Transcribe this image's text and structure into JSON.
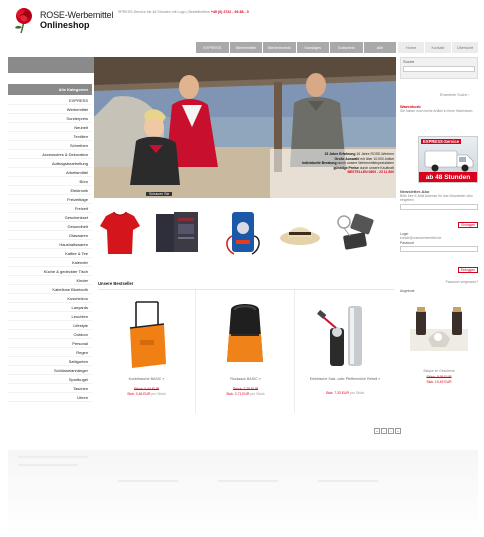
{
  "header": {
    "brand_line1": "ROSE-Werbemittel",
    "brand_line2": "Onlineshop",
    "top_info_text": "SPRESS-Service bis 48 Stunden mit Logo | Bestellhotline",
    "top_info_phone": "+49 (0) 2722 - 93 88 - 0"
  },
  "top_nav": [
    "EXPRESS",
    "Werbemittel",
    "Werbetechnik",
    "Sonstiges",
    "Gutschein",
    "Alle"
  ],
  "service_nav": [
    "Home",
    "Kontakt",
    "Übersicht"
  ],
  "search": {
    "label": "Suche",
    "advanced": "Erweiterte Suche ›"
  },
  "sidebar": {
    "heading": "Alle Kategorien",
    "items": [
      "EXPRESS",
      "Werbemittel",
      "Sonderpreis",
      "Neuheit",
      "Textilien",
      "Schreiben",
      "Accessoires & Dekoration",
      "Auftragsbearbeitung",
      "Arbeitsmittel",
      "Büro",
      "Elektronik",
      "Freizeittage",
      "Freizeit",
      "Geschenkset",
      "Gesundheit",
      "Glaswaren",
      "Haushaltswaren",
      "Kaffee & Tee",
      "Kalender",
      "Küche & gedeckter Tisch",
      "Kinder",
      "Kabellose Bluetooth",
      "Kuschelzoo",
      "Lanyards",
      "Leuchten",
      "Lifestyle",
      "Outdoor",
      "Personal",
      "Regen",
      "Sattigurten",
      "Schlüsselanhänger",
      "Sportkugel",
      "Taschen",
      "Uhren"
    ]
  },
  "hero": {
    "line1": "15 Jahre Erfahrung",
    "line1b": "16 Jahre ROSE-Werbem",
    "line2": "Große Auswahl",
    "line2b": "mit über 10.000 Artikel",
    "line3": "Individuelle Beratung",
    "line3b": "durch unsere Werbemittelspezialisten",
    "line4": "günstige Preise",
    "line4b": "durch unsere Kaufkraft",
    "phone": "BESTELLEN 0800 - 23 11 800",
    "link": "Schauen Sie"
  },
  "bestseller": {
    "heading": "Unsere Bestseller",
    "items": [
      {
        "name": "Kordeltasche BASIC »",
        "old": "Stück: 0,44 EUR",
        "price": "Stck: 0,46 EUR",
        "unit": "pro Stück"
      },
      {
        "name": "Rucksack BASIC »",
        "old": "Stück: 2,28 EUR",
        "price": "Stck: 2,71 EUR",
        "unit": "pro Stück"
      },
      {
        "name": "Elektrische Salz- oder Pfeffermühle Rebell »",
        "old": "",
        "price": "Stck: 7,33 EUR",
        "unit": "pro Stück"
      }
    ]
  },
  "pager": [
    "«",
    "‹",
    "›",
    "»"
  ],
  "right": {
    "warenkorb_head": "Warenkorb",
    "warenkorb_text": "Sie haben noch keine Artikel in Ihren Warenkorb.",
    "express_label": "EXPRESS-Service",
    "express_hours": "ab 48 Stunden",
    "newsletter_head": "Newsletter-Abo",
    "newsletter_text": "Bitte Ihre E-Mail Adresse für das Newsletter-Abo eingeben",
    "newsletter_button": "Eintragen",
    "login_label": "Login",
    "login_email_ph": "kunde@rosewerbemittel.de",
    "password_label": "Passwort",
    "login_button": "Einloggen",
    "forgot": "Passwort vergessen?",
    "offer_head": "Angebote",
    "offer_name": "Bisque im Geschenk",
    "offer_old": "Stück: 9,95 EUR",
    "offer_price": "Stck: 10,49 EUR"
  },
  "colors": {
    "accent": "#d9001b",
    "nav_grey": "#a9a9a9",
    "band_grey": "#8a8a8a"
  }
}
